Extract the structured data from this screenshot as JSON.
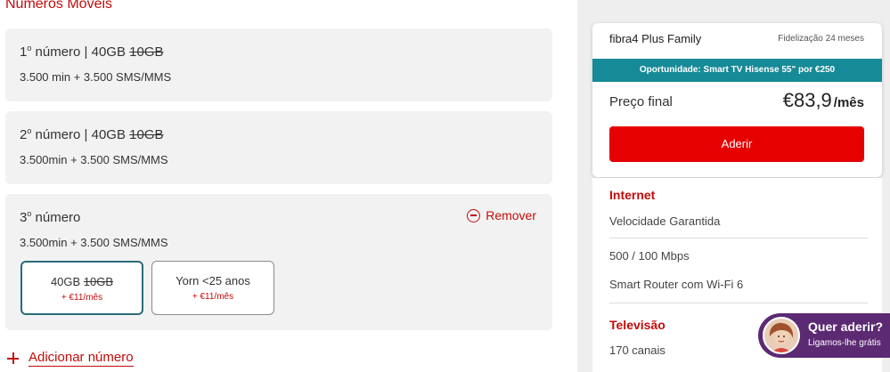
{
  "section": {
    "title": "Números Móveis"
  },
  "numbers": [
    {
      "title_prefix": "1",
      "title_sup": "o",
      "title_main": " número | 40GB ",
      "title_strike": "10GB",
      "details": "3.500 min + 3.500 SMS/MMS"
    },
    {
      "title_prefix": "2",
      "title_sup": "o",
      "title_main": " número | 40GB ",
      "title_strike": "10GB",
      "details": "3.500min + 3.500 SMS/MMS"
    },
    {
      "title_prefix": "3",
      "title_sup": "o",
      "title_main": " número",
      "details": "3.500min + 3.500 SMS/MMS",
      "remove_label": "Remover",
      "options": [
        {
          "name": "40GB ",
          "name_strike": "10GB",
          "price": "+ €11/mês",
          "selected": true
        },
        {
          "name": "Yorn <25 anos",
          "price": "+ €11/mês",
          "selected": false
        }
      ]
    }
  ],
  "add_number": {
    "label": "Adicionar número",
    "icon": "plus-icon"
  },
  "offer": {
    "plan_name": "fibra4 Plus Family",
    "commitment": "Fidelização 24 meses",
    "banner": "Oportunidade: Smart TV Hisense 55\" por €250",
    "price_label": "Preço final",
    "price": "€83,9",
    "price_period": "/mês",
    "cta": "Aderir"
  },
  "details": {
    "internet_title": "Internet",
    "internet_items": [
      "Velocidade Garantida",
      "500 / 100 Mbps",
      "Smart Router com Wi-Fi 6"
    ],
    "tv_title": "Televisão",
    "tv_items": [
      "170 canais"
    ]
  },
  "chat": {
    "title": "Quer aderir?",
    "subtitle": "Ligamos-lhe grátis"
  },
  "colors": {
    "accent_red": "#e60000",
    "text_red": "#c40a0a",
    "teal": "#178a97",
    "chat_purple": "#5c2a73"
  }
}
